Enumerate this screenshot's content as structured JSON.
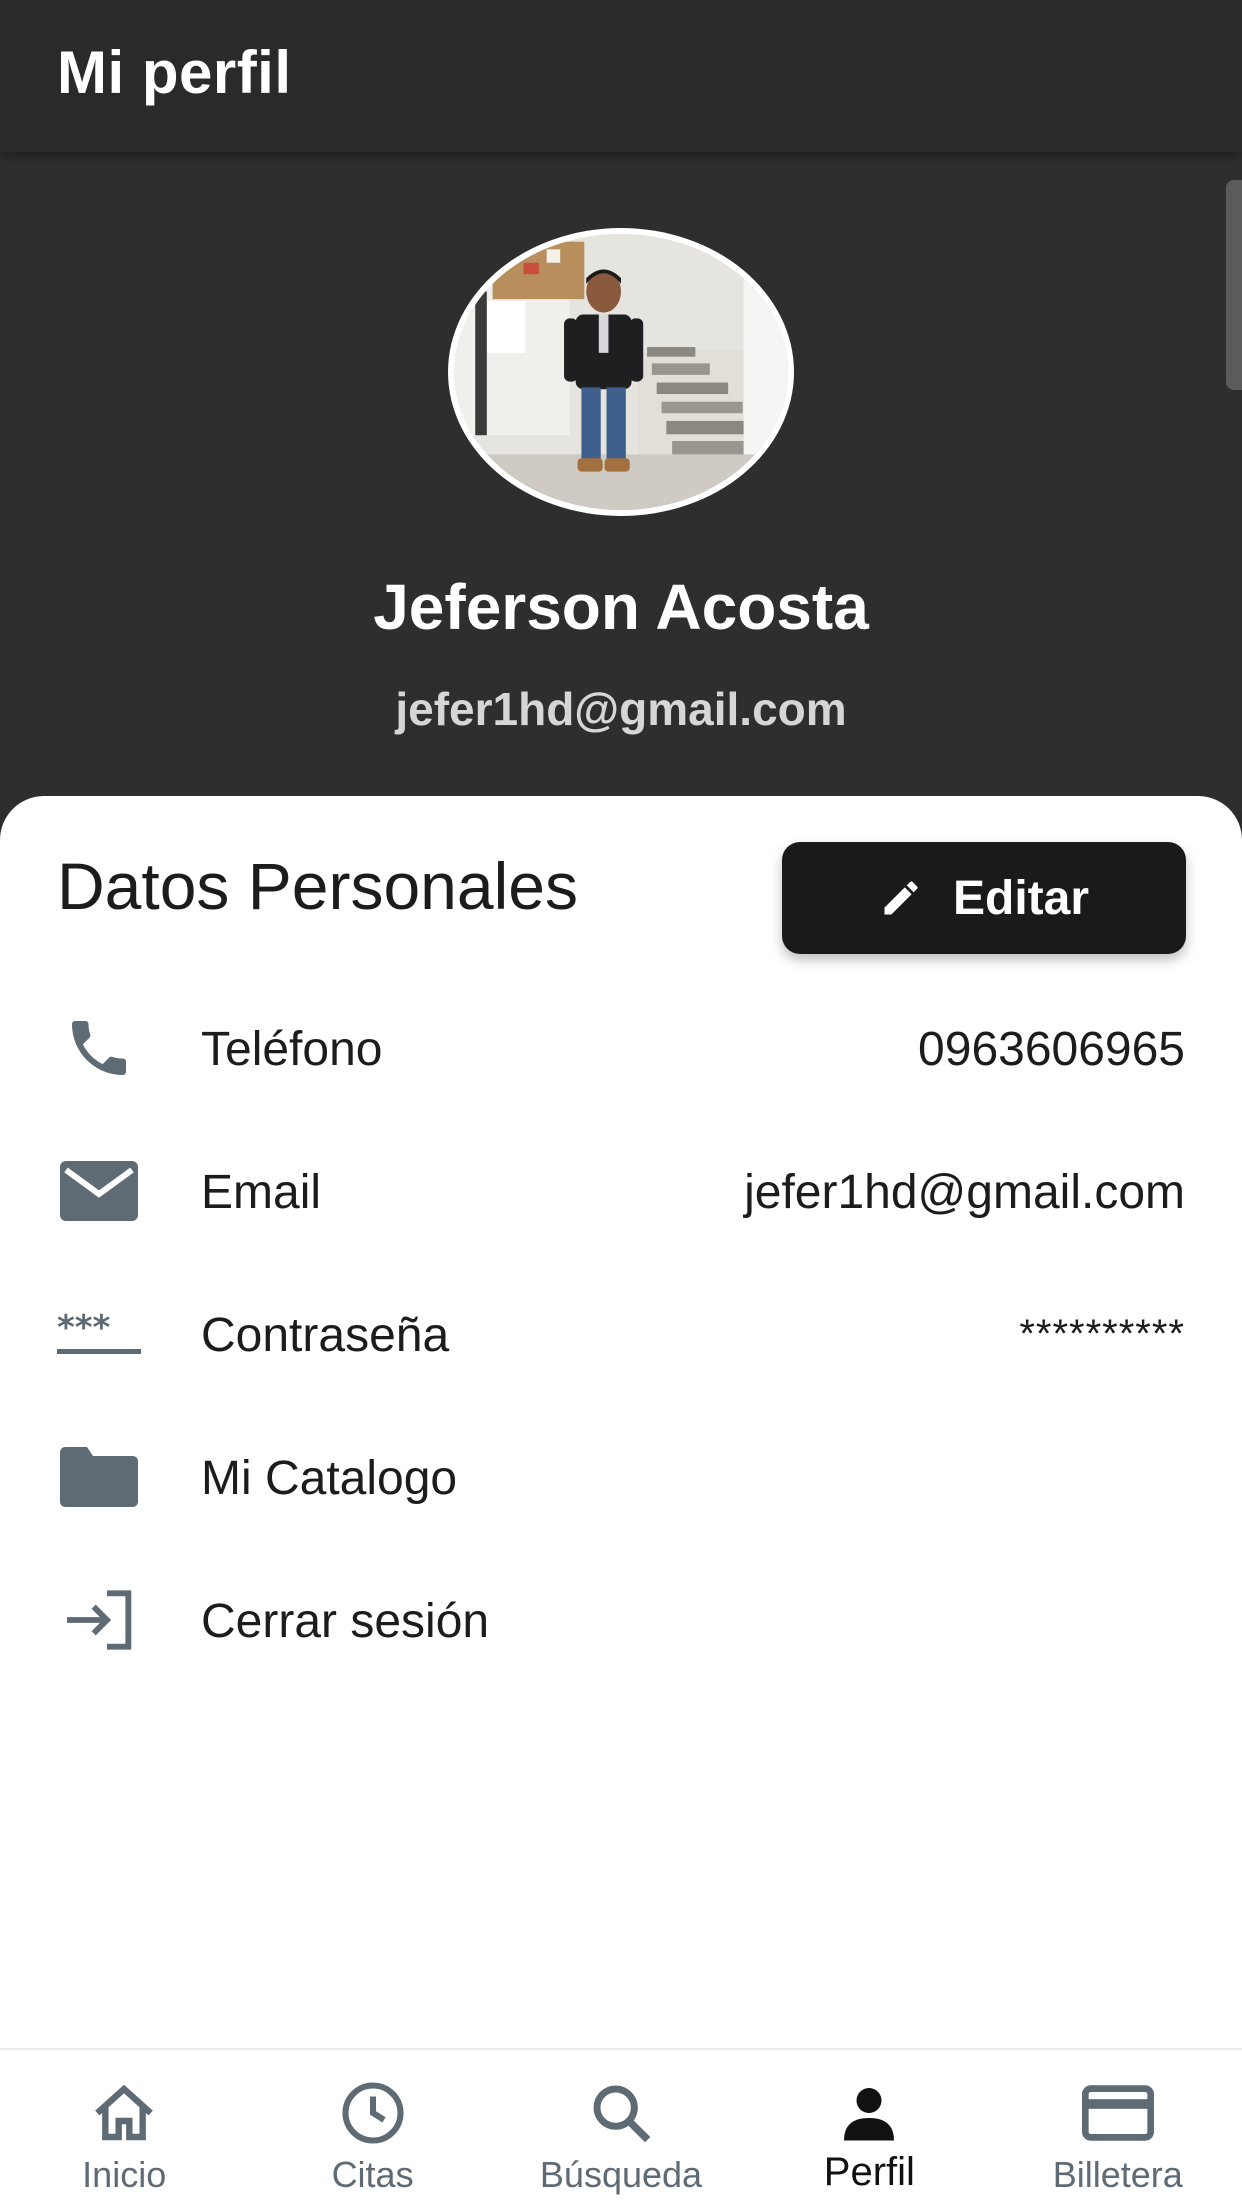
{
  "app_bar": {
    "title": "Mi perfil"
  },
  "profile": {
    "name": "Jeferson Acosta",
    "email": "jefer1hd@gmail.com"
  },
  "personal_data": {
    "section_title": "Datos Personales",
    "edit_button_label": "Editar",
    "rows": [
      {
        "icon": "phone-icon",
        "label": "Teléfono",
        "value": "0963606965"
      },
      {
        "icon": "mail-icon",
        "label": "Email",
        "value": "jefer1hd@gmail.com"
      },
      {
        "icon": "password-icon",
        "label": "Contraseña",
        "value": "**********"
      },
      {
        "icon": "folder-icon",
        "label": "Mi Catalogo",
        "value": ""
      },
      {
        "icon": "logout-icon",
        "label": "Cerrar sesión",
        "value": ""
      }
    ]
  },
  "bottom_nav": {
    "items": [
      {
        "icon": "home-icon",
        "label": "Inicio",
        "active": false
      },
      {
        "icon": "clock-icon",
        "label": "Citas",
        "active": false
      },
      {
        "icon": "search-icon",
        "label": "Búsqueda",
        "active": false
      },
      {
        "icon": "person-icon",
        "label": "Perfil",
        "active": true
      },
      {
        "icon": "card-icon",
        "label": "Billetera",
        "active": false
      }
    ]
  },
  "colors": {
    "header_bg": "#2e2e2f",
    "app_bar_bg": "#2a2a2b",
    "button_bg": "#1a1a1a",
    "icon_gray": "#5e6a74",
    "text_dark": "#1c1c1c"
  }
}
